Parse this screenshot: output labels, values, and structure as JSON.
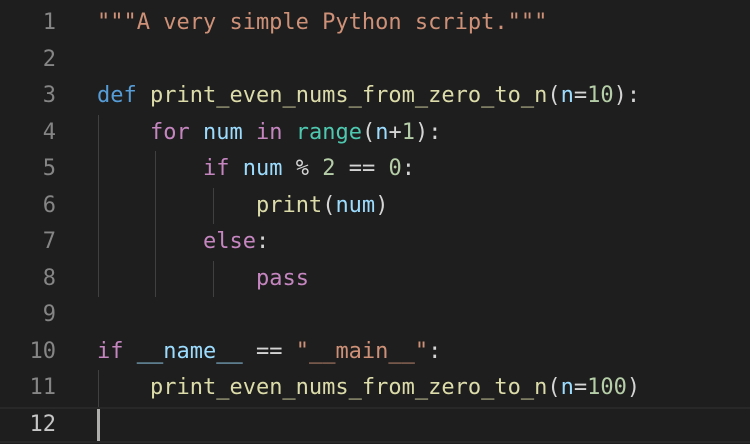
{
  "colors": {
    "background": "#1e1e1e",
    "line_number": "#858585",
    "line_number_active": "#c6c6c6",
    "string": "#ce9178",
    "keyword_storage": "#569cd6",
    "keyword_control": "#c586c0",
    "function": "#dcdcaa",
    "variable": "#9cdcfe",
    "builtin_class": "#4ec9b0",
    "number": "#b5cea8",
    "plain": "#d4d4d4"
  },
  "editor": {
    "cursor_line": 12,
    "lines": [
      {
        "num": "1",
        "tokens": [
          {
            "t": "\"\"\"A very simple Python script.\"\"\"",
            "c": "string"
          }
        ]
      },
      {
        "num": "2",
        "tokens": []
      },
      {
        "num": "3",
        "tokens": [
          {
            "t": "def",
            "c": "keyword_storage"
          },
          {
            "t": " ",
            "c": "plain"
          },
          {
            "t": "print_even_nums_from_zero_to_n",
            "c": "function"
          },
          {
            "t": "(",
            "c": "plain"
          },
          {
            "t": "n",
            "c": "variable"
          },
          {
            "t": "=",
            "c": "plain"
          },
          {
            "t": "10",
            "c": "number"
          },
          {
            "t": "):",
            "c": "plain"
          }
        ]
      },
      {
        "num": "4",
        "tokens": [
          {
            "t": "    ",
            "c": "plain"
          },
          {
            "t": "for",
            "c": "keyword_control"
          },
          {
            "t": " ",
            "c": "plain"
          },
          {
            "t": "num",
            "c": "variable"
          },
          {
            "t": " ",
            "c": "plain"
          },
          {
            "t": "in",
            "c": "keyword_control"
          },
          {
            "t": " ",
            "c": "plain"
          },
          {
            "t": "range",
            "c": "builtin_class"
          },
          {
            "t": "(",
            "c": "plain"
          },
          {
            "t": "n",
            "c": "variable"
          },
          {
            "t": "+",
            "c": "plain"
          },
          {
            "t": "1",
            "c": "number"
          },
          {
            "t": "):",
            "c": "plain"
          }
        ]
      },
      {
        "num": "5",
        "tokens": [
          {
            "t": "        ",
            "c": "plain"
          },
          {
            "t": "if",
            "c": "keyword_control"
          },
          {
            "t": " ",
            "c": "plain"
          },
          {
            "t": "num",
            "c": "variable"
          },
          {
            "t": " % ",
            "c": "plain"
          },
          {
            "t": "2",
            "c": "number"
          },
          {
            "t": " == ",
            "c": "plain"
          },
          {
            "t": "0",
            "c": "number"
          },
          {
            "t": ":",
            "c": "plain"
          }
        ]
      },
      {
        "num": "6",
        "tokens": [
          {
            "t": "            ",
            "c": "plain"
          },
          {
            "t": "print",
            "c": "function"
          },
          {
            "t": "(",
            "c": "plain"
          },
          {
            "t": "num",
            "c": "variable"
          },
          {
            "t": ")",
            "c": "plain"
          }
        ]
      },
      {
        "num": "7",
        "tokens": [
          {
            "t": "        ",
            "c": "plain"
          },
          {
            "t": "else",
            "c": "keyword_control"
          },
          {
            "t": ":",
            "c": "plain"
          }
        ]
      },
      {
        "num": "8",
        "tokens": [
          {
            "t": "            ",
            "c": "plain"
          },
          {
            "t": "pass",
            "c": "keyword_control"
          }
        ]
      },
      {
        "num": "9",
        "tokens": []
      },
      {
        "num": "10",
        "tokens": [
          {
            "t": "if",
            "c": "keyword_control"
          },
          {
            "t": " ",
            "c": "plain"
          },
          {
            "t": "__name__",
            "c": "variable"
          },
          {
            "t": " == ",
            "c": "plain"
          },
          {
            "t": "\"__main__\"",
            "c": "string"
          },
          {
            "t": ":",
            "c": "plain"
          }
        ]
      },
      {
        "num": "11",
        "tokens": [
          {
            "t": "    ",
            "c": "plain"
          },
          {
            "t": "print_even_nums_from_zero_to_n",
            "c": "function"
          },
          {
            "t": "(",
            "c": "plain"
          },
          {
            "t": "n",
            "c": "variable"
          },
          {
            "t": "=",
            "c": "plain"
          },
          {
            "t": "100",
            "c": "number"
          },
          {
            "t": ")",
            "c": "plain"
          }
        ]
      },
      {
        "num": "12",
        "tokens": []
      }
    ]
  }
}
